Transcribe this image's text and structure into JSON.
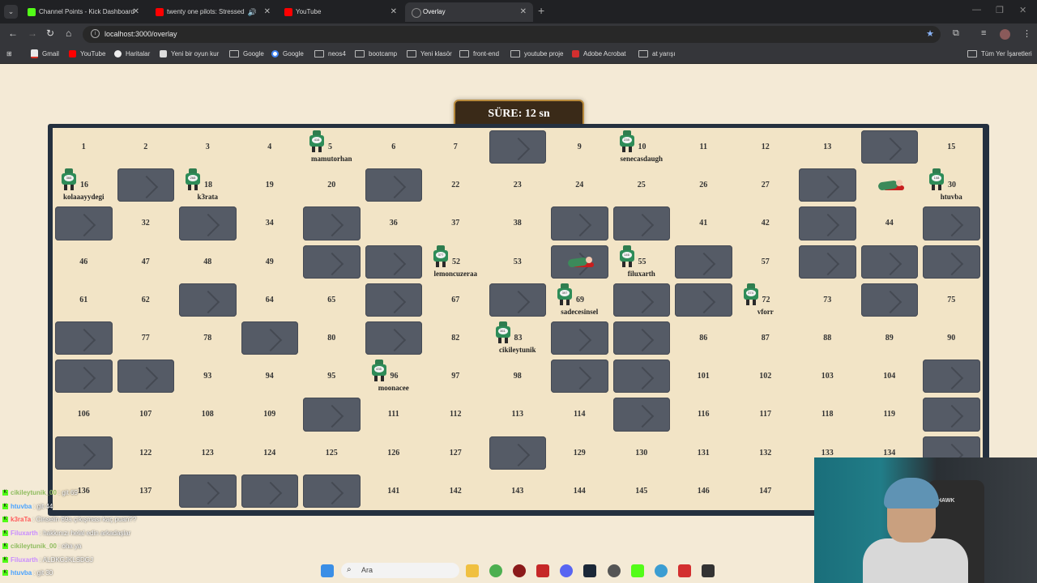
{
  "browser": {
    "tabs": [
      {
        "title": "Channel Points - Kick Dashboard",
        "favicon_color": "#53fc18"
      },
      {
        "title": "twenty one pilots: Stressed",
        "favicon_color": "#ff0000"
      },
      {
        "title": "YouTube",
        "favicon_color": "#ff0000"
      },
      {
        "title": "Overlay",
        "favicon_color": "#5f6368"
      }
    ],
    "url": "localhost:3000/overlay",
    "bookmarks": [
      "Gmail",
      "YouTube",
      "Haritalar",
      "Yeni bir oyun kur",
      "Google",
      "Google",
      "neos4",
      "bootcamp",
      "Yeni klasör",
      "front-end",
      "youtube proje",
      "Adobe Acrobat",
      "at yarışı",
      "Tüm Yer İşaretleri"
    ]
  },
  "game": {
    "timer_label": "SÜRE: 12 sn",
    "numbers": [
      "1",
      "2",
      "3",
      "4",
      "5",
      "6",
      "7",
      "",
      "9",
      "10",
      "11",
      "12",
      "13",
      "",
      "15",
      "16",
      "",
      "18",
      "19",
      "20",
      "",
      "22",
      "23",
      "24",
      "25",
      "26",
      "27",
      "",
      "",
      "30",
      "",
      "32",
      "",
      "34",
      "",
      "36",
      "37",
      "38",
      "",
      "",
      "41",
      "42",
      "",
      "44",
      "",
      "46",
      "47",
      "48",
      "49",
      "",
      "",
      "52",
      "53",
      "",
      "55",
      "",
      "57",
      "",
      "",
      "",
      "61",
      "62",
      "",
      "64",
      "65",
      "",
      "67",
      "",
      "69",
      "",
      "",
      "72",
      "73",
      "",
      "75",
      "",
      "77",
      "78",
      "",
      "80",
      "",
      "82",
      "83",
      "",
      "",
      "86",
      "87",
      "88",
      "89",
      "90",
      "",
      "",
      "93",
      "94",
      "95",
      "96",
      "97",
      "98",
      "",
      "",
      "101",
      "102",
      "103",
      "104",
      "",
      "106",
      "107",
      "108",
      "109",
      "",
      "111",
      "112",
      "113",
      "114",
      "",
      "116",
      "117",
      "118",
      "119",
      "",
      "",
      "122",
      "123",
      "124",
      "125",
      "126",
      "127",
      "",
      "129",
      "130",
      "131",
      "132",
      "133",
      "134",
      "",
      "136",
      "137",
      "",
      "",
      "",
      "141",
      "142",
      "143",
      "144",
      "145",
      "146",
      "147",
      "",
      "",
      ""
    ],
    "walls": [
      8,
      14,
      17,
      21,
      28,
      31,
      33,
      35,
      39,
      40,
      43,
      45,
      50,
      51,
      54,
      56,
      58,
      59,
      60,
      63,
      66,
      68,
      70,
      71,
      74,
      76,
      79,
      81,
      84,
      85,
      91,
      92,
      99,
      100,
      105,
      110,
      115,
      120,
      121,
      128,
      135,
      138,
      139,
      140
    ],
    "players": [
      {
        "name": "mamutorhan",
        "cell": 5,
        "badge": "416"
      },
      {
        "name": "senecasdaugh",
        "cell": 10,
        "badge": "239"
      },
      {
        "name": "kolaaayydegi",
        "cell": 16,
        "badge": "366"
      },
      {
        "name": "k3rata",
        "cell": 18,
        "badge": "268"
      },
      {
        "name": "htuvba",
        "cell": 30,
        "badge": "108"
      },
      {
        "name": "lemoncuzeraa",
        "cell": 52,
        "badge": "377"
      },
      {
        "name": "filuxarth",
        "cell": 55,
        "badge": "146"
      },
      {
        "name": "sadecesinsel",
        "cell": 69,
        "badge": "397"
      },
      {
        "name": "vforr",
        "cell": 72,
        "badge": "374"
      },
      {
        "name": "cikileytunik",
        "cell": 83,
        "badge": "361"
      },
      {
        "name": "moonacee",
        "cell": 96,
        "badge": "435"
      }
    ],
    "dead_players": [
      29,
      54
    ]
  },
  "chat": [
    {
      "user": "cikileytunik_00",
      "text": ": git 69",
      "color": "#8fbc5f"
    },
    {
      "user": "htuvba",
      "text": ": git 44",
      "color": "#4aa3ff"
    },
    {
      "user": "k3raTa",
      "text": ": Cinselin 69a çıkışması kaç puan??",
      "color": "#ff5a5a"
    },
    {
      "user": "Filuxarth",
      "text": ": hakkınızı helal edin arkadaşlar",
      "color": "#c98cff"
    },
    {
      "user": "cikileytunik_00",
      "text": ": oha ya",
      "color": "#8fbc5f"
    },
    {
      "user": "Filuxarth",
      "text": ": ALDKGJKLSDGJ",
      "color": "#c98cff"
    },
    {
      "user": "htuvba",
      "text": ": git 30",
      "color": "#4aa3ff"
    }
  ],
  "webcam": {
    "chair_brand": "HAWK"
  },
  "taskbar": {
    "search_placeholder": "Ara"
  }
}
